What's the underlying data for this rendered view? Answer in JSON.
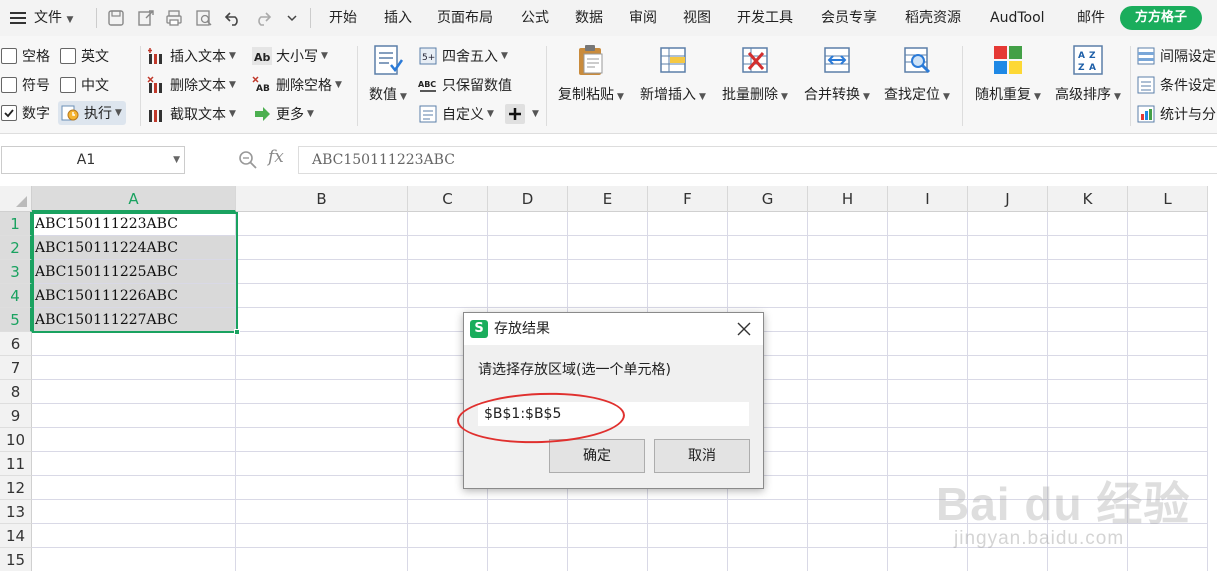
{
  "menubar": {
    "file_label": "文件",
    "tabs": [
      "开始",
      "插入",
      "页面布局",
      "公式",
      "数据",
      "审阅",
      "视图",
      "开发工具",
      "会员专享",
      "稻壳资源",
      "AudTool",
      "邮件"
    ],
    "member_button": "方方格子"
  },
  "ribbon": {
    "checkboxes": [
      {
        "label": "空格",
        "checked": false
      },
      {
        "label": "英文",
        "checked": false
      },
      {
        "label": "符号",
        "checked": false
      },
      {
        "label": "中文",
        "checked": false
      },
      {
        "label": "数字",
        "checked": true
      }
    ],
    "execute_label": "执行",
    "text_tools": [
      "插入文本",
      "删除文本",
      "截取文本"
    ],
    "case_tools": [
      "大小写",
      "删除空格",
      "更多"
    ],
    "number_label": "数值",
    "number_tools": [
      "四舍五入",
      "只保留数值",
      "自定义"
    ],
    "big_buttons": [
      "复制粘贴",
      "新增插入",
      "批量删除",
      "合并转换",
      "查找定位",
      "随机重复",
      "高级排序"
    ],
    "right_tools": [
      "间隔设定",
      "条件设定",
      "统计与分"
    ]
  },
  "formula_bar": {
    "name_box": "A1",
    "fx_symbol": "fx",
    "formula": "ABC150111223ABC"
  },
  "sheet": {
    "columns": [
      "A",
      "B",
      "C",
      "D",
      "E",
      "F",
      "G",
      "H",
      "I",
      "J",
      "K",
      "L"
    ],
    "rows": [
      "1",
      "2",
      "3",
      "4",
      "5",
      "6",
      "7",
      "8",
      "9",
      "10",
      "11",
      "12",
      "13",
      "14",
      "15"
    ],
    "column_a_values": [
      "ABC150111223ABC",
      "ABC150111224ABC",
      "ABC150111225ABC",
      "ABC150111226ABC",
      "ABC150111227ABC"
    ],
    "selection_color": "#1aa260"
  },
  "dialog": {
    "logo": "S",
    "title": "存放结果",
    "prompt": "请选择存放区域(选一个单元格)",
    "range_value": "$B$1:$B$5",
    "ok_label": "确定",
    "cancel_label": "取消",
    "highlight_color": "#e0302e"
  },
  "watermark": {
    "brand": "Bai du 经验",
    "sub": "jingyan.baidu.com"
  }
}
